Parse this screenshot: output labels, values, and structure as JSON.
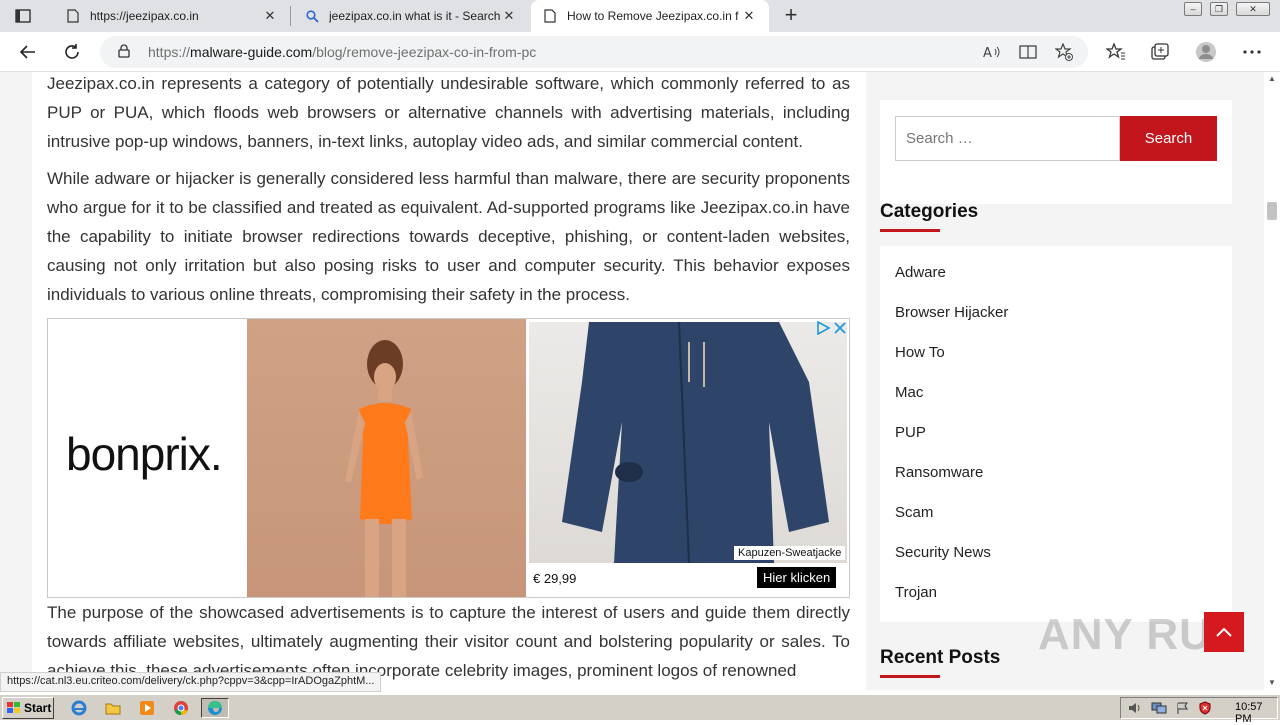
{
  "browser": {
    "tabs": [
      {
        "title": "https://jeezipax.co.in",
        "icon": "page-icon"
      },
      {
        "title": "jeezipax.co.in what is it - Search",
        "icon": "search-icon"
      },
      {
        "title": "How to Remove Jeezipax.co.in f",
        "icon": "page-icon"
      }
    ],
    "url_prefix": "https://",
    "url_host": "malware-guide.com",
    "url_path": "/blog/remove-jeezipax-co-in-from-pc"
  },
  "article": {
    "para1": "Jeezipax.co.in represents a category of potentially undesirable software, which commonly referred to as PUP or PUA, which floods web browsers or alternative channels with advertising materials, including intrusive pop-up windows, banners, in-text links, autoplay video ads, and similar commercial content.",
    "para2": "While adware or hijacker is generally considered less harmful than malware, there are security proponents who argue for it to be classified and treated as equivalent. Ad-supported programs like Jeezipax.co.in have the capability to initiate browser redirections towards deceptive, phishing, or content-laden websites, causing not only irritation but also posing risks to user and computer security. This behavior exposes individuals to various online threats, compromising their safety in the process.",
    "para3": "The purpose of the showcased advertisements is to capture the interest of users and guide them directly towards affiliate websites, ultimately augmenting their visitor count and bolstering popularity or sales. To achieve this, these advertisements often incorporate celebrity images, prominent logos of renowned"
  },
  "ad": {
    "brand": "bonprix.",
    "product": "Kapuzen-Sweatjacke",
    "price": "€ 29,99",
    "cta": "Hier klicken"
  },
  "sidebar": {
    "search_placeholder": "Search …",
    "search_button": "Search",
    "categories_title": "Categories",
    "categories": [
      "Adware",
      "Browser Hijacker",
      "How To",
      "Mac",
      "PUP",
      "Ransomware",
      "Scam",
      "Security News",
      "Trojan"
    ],
    "recent_title": "Recent Posts"
  },
  "status_url": "https://cat.nl3.eu.criteo.com/delivery/ck.php?cppv=3&cpp=IrADOgaZphtM...",
  "watermark": "ANY RUN",
  "taskbar": {
    "start_label": "Start",
    "clock": "10:57 PM"
  },
  "colors": {
    "accent": "#c2161c",
    "ad_dress": "#ff7a1a",
    "ad_jacket": "#2e4468"
  }
}
